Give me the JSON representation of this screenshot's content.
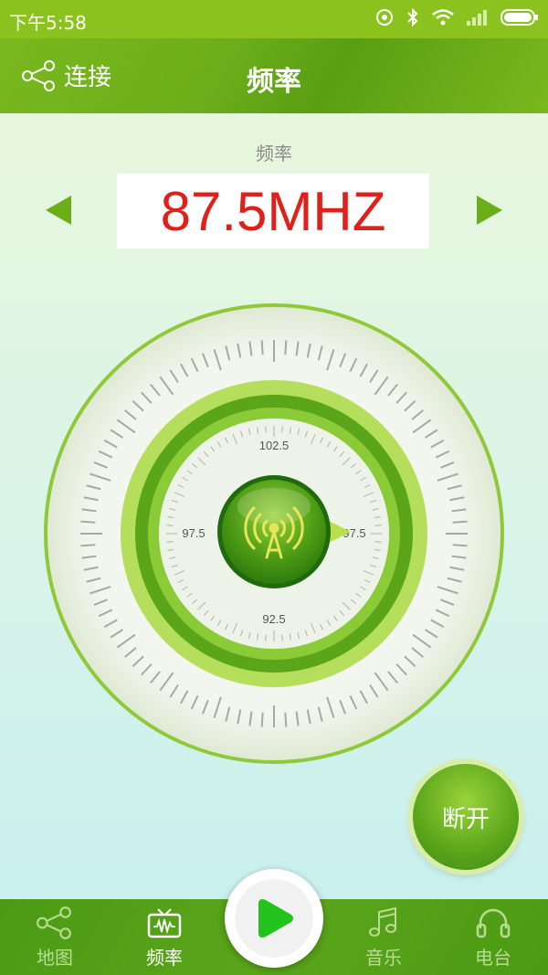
{
  "status_bar": {
    "time": "下午5:58"
  },
  "header": {
    "connect_label": "连接",
    "title": "频率"
  },
  "frequency": {
    "label": "频率",
    "value": "87.5MHZ"
  },
  "dial": {
    "ticks": {
      "top": "102.5",
      "left": "97.5",
      "right": "97.5",
      "bottom": "92.5"
    }
  },
  "actions": {
    "disconnect_label": "断开"
  },
  "nav": {
    "items": [
      {
        "label": "地图",
        "icon": "share-icon"
      },
      {
        "label": "频率",
        "icon": "tv-icon"
      },
      {
        "label": "音乐",
        "icon": "music-icon"
      },
      {
        "label": "电台",
        "icon": "headphone-icon"
      }
    ],
    "play_icon": "play-icon"
  },
  "colors": {
    "accent": "#6cae1a",
    "frequency_text": "#e0201a",
    "play": "#22c31c"
  }
}
